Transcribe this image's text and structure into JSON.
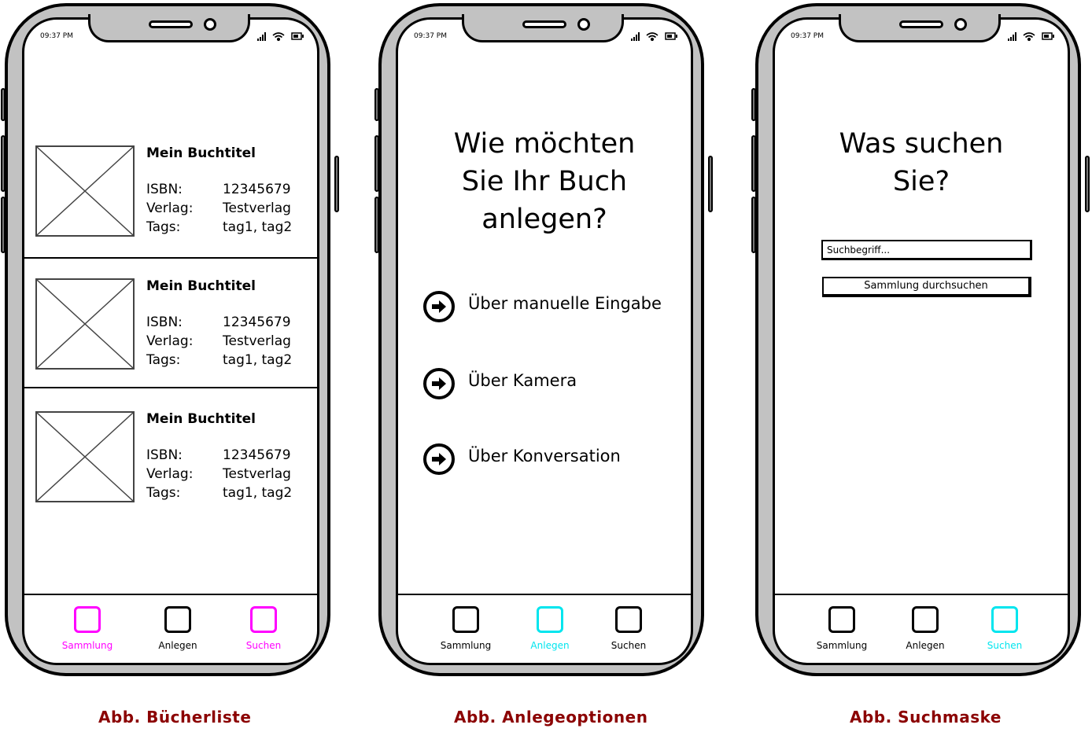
{
  "status_bar": {
    "time": "09:37 PM"
  },
  "tabbar": {
    "items": [
      {
        "label": "Sammlung"
      },
      {
        "label": "Anlegen"
      },
      {
        "label": "Suchen"
      }
    ],
    "colors": {
      "inactive": "#000000",
      "phone1_active": "#ff00ff",
      "phone2_active": "#00e5ee",
      "phone3_active": "#00e5ee"
    }
  },
  "book_list": {
    "books": [
      {
        "title": "Mein Buchtitel",
        "isbn_label": "ISBN:",
        "isbn": "12345679",
        "publisher_label": "Verlag:",
        "publisher": "Testverlag",
        "tags_label": "Tags:",
        "tags": "tag1, tag2"
      },
      {
        "title": "Mein Buchtitel",
        "isbn_label": "ISBN:",
        "isbn": "12345679",
        "publisher_label": "Verlag:",
        "publisher": "Testverlag",
        "tags_label": "Tags:",
        "tags": "tag1, tag2"
      },
      {
        "title": "Mein Buchtitel",
        "isbn_label": "ISBN:",
        "isbn": "12345679",
        "publisher_label": "Verlag:",
        "publisher": "Testverlag",
        "tags_label": "Tags:",
        "tags": "tag1, tag2"
      }
    ]
  },
  "add_options": {
    "heading_lines": [
      "Wie möchten",
      "Sie Ihr Buch",
      "anlegen?"
    ],
    "options": [
      {
        "label": "Über manuelle Eingabe",
        "icon": "arrow-right-circle-icon"
      },
      {
        "label": "Über Kamera",
        "icon": "arrow-right-circle-icon"
      },
      {
        "label": "Über Konversation",
        "icon": "arrow-right-circle-icon"
      }
    ]
  },
  "search": {
    "heading_lines": [
      "Was suchen",
      "Sie?"
    ],
    "input_placeholder": "Suchbegriff...",
    "button_label": "Sammlung durchsuchen"
  },
  "captions": [
    "Abb. Bücherliste",
    "Abb. Anlegeoptionen",
    "Abb. Suchmaske"
  ],
  "caption_color": "#8b0000"
}
